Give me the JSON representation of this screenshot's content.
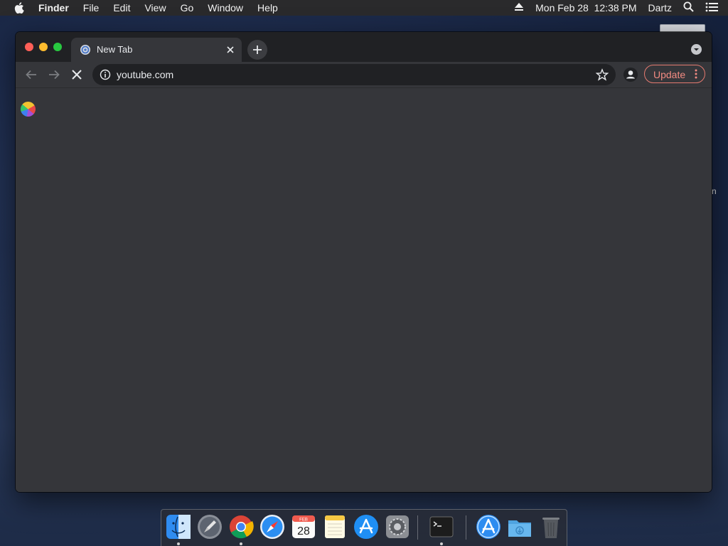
{
  "menubar": {
    "app_name": "Finder",
    "items": [
      "File",
      "Edit",
      "View",
      "Go",
      "Window",
      "Help"
    ],
    "datetime": "Mon Feb 28  12:38 PM",
    "user": "Dartz"
  },
  "desktop": {
    "partial_label": "n"
  },
  "browser": {
    "tab_title": "New Tab",
    "url": "youtube.com",
    "update_label": "Update",
    "page_state": "loading"
  },
  "dock": {
    "items": [
      {
        "name": "finder",
        "running": true
      },
      {
        "name": "launchpad",
        "running": false
      },
      {
        "name": "google-chrome",
        "running": true
      },
      {
        "name": "safari",
        "running": false
      },
      {
        "name": "calendar",
        "running": false
      },
      {
        "name": "notes",
        "running": false
      },
      {
        "name": "app-store",
        "running": false
      },
      {
        "name": "system-preferences",
        "running": false
      },
      {
        "name": "terminal",
        "running": true
      },
      {
        "name": "applications-folder",
        "running": false
      },
      {
        "name": "downloads-folder",
        "running": false
      },
      {
        "name": "trash",
        "running": false
      }
    ],
    "calendar": {
      "month": "FEB",
      "day": "28"
    }
  },
  "colors": {
    "accent_update": "#f28b82",
    "window_bg": "#35363a",
    "tabstrip_bg": "#202124"
  }
}
